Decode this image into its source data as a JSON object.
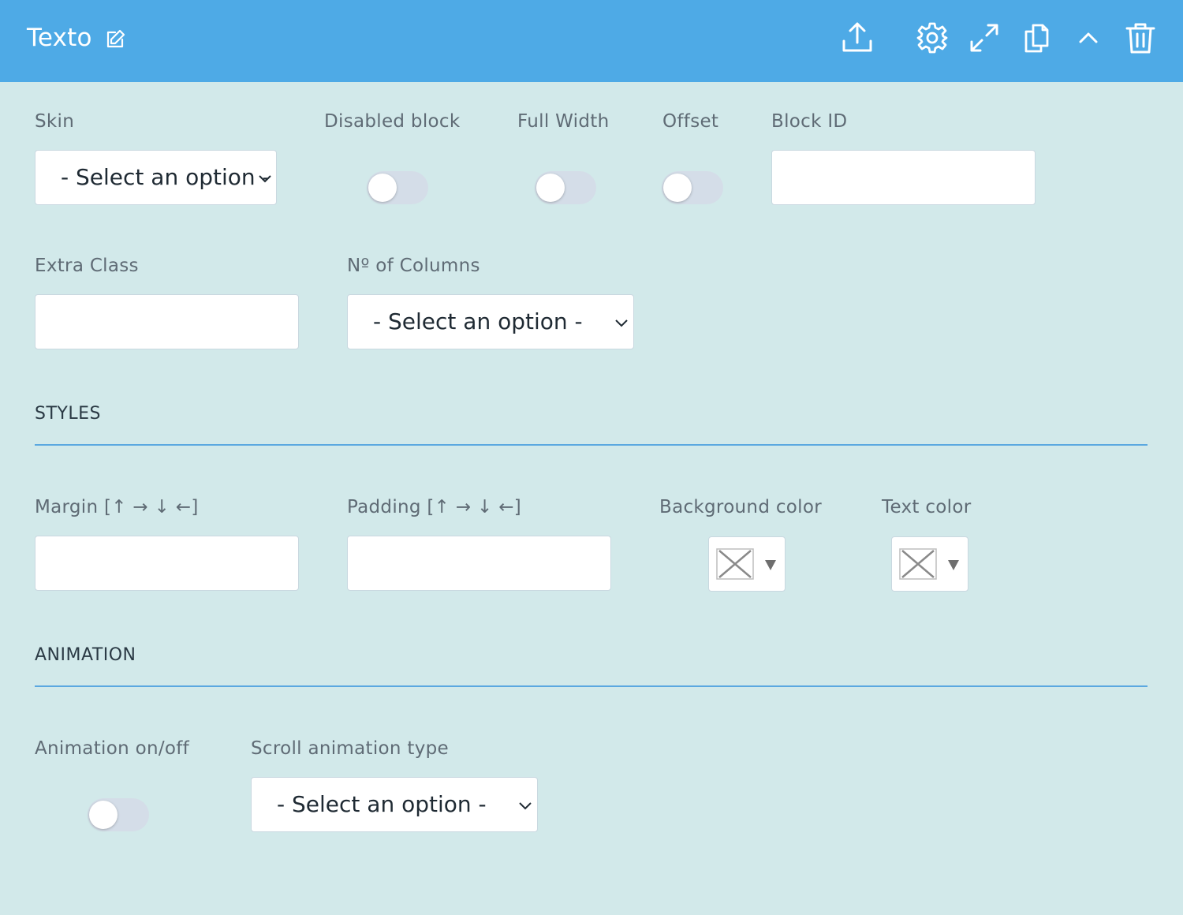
{
  "header": {
    "title": "Texto",
    "icons": [
      "edit-icon",
      "upload-icon",
      "gear-icon",
      "expand-icon",
      "copy-icon",
      "chevron-up-icon",
      "trash-icon"
    ],
    "bg_color": "#4eaae6"
  },
  "fields": {
    "skin": {
      "label": "Skin",
      "value": "- Select an option -"
    },
    "disabled_block": {
      "label": "Disabled block",
      "on": false
    },
    "full_width": {
      "label": "Full Width",
      "on": false
    },
    "offset": {
      "label": "Offset",
      "on": false
    },
    "block_id": {
      "label": "Block ID",
      "value": ""
    },
    "extra_class": {
      "label": "Extra Class",
      "value": ""
    },
    "columns": {
      "label": "Nº of Columns",
      "value": "- Select an option -"
    }
  },
  "styles": {
    "heading": "STYLES",
    "margin": {
      "label": "Margin [↑ → ↓ ←]",
      "value": ""
    },
    "padding": {
      "label": "Padding [↑ → ↓ ←]",
      "value": ""
    },
    "background_color": {
      "label": "Background color"
    },
    "text_color": {
      "label": "Text color"
    }
  },
  "animation": {
    "heading": "ANIMATION",
    "toggle": {
      "label": "Animation on/off",
      "on": false
    },
    "scroll_type": {
      "label": "Scroll animation type",
      "value": "- Select an option -"
    }
  },
  "colors": {
    "page_bg": "#d2e9ea",
    "accent": "#5ba8e0",
    "toggle_off": "#d4dde8"
  }
}
